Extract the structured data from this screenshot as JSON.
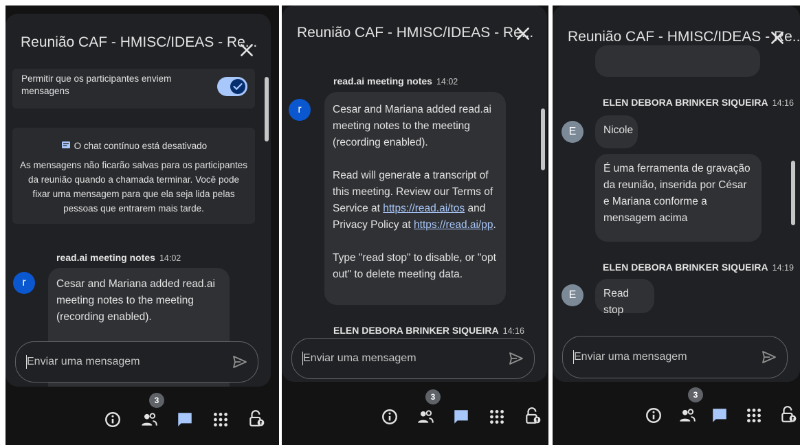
{
  "app": {
    "title": "Reunião CAF - HMISC/IDEAS - Re..."
  },
  "settings": {
    "allow_messages_label": "Permitir que os participantes enviem mensagens",
    "continuous_chat_title": "O chat contínuo está desativado",
    "continuous_chat_body": "As mensagens não ficarão salvas para os participantes da reunião quando a chamada terminar. Você pode fixar uma mensagem para que ela seja lida pelas pessoas que entrarem mais tarde."
  },
  "messages": {
    "readai": {
      "sender": "read.ai meeting notes",
      "time": "14:02",
      "avatar": "r",
      "para1": "Cesar and Mariana added read.ai meeting notes to the meeting (recording enabled).",
      "para2_pre": "Read will generate a transcript of this meeting. Review our Terms of Service at ",
      "tos_link": "https://read.ai/tos",
      "para2_mid": " and Privacy Policy at ",
      "pp_link": "https://read.ai/pp",
      "para2_end": ".",
      "para3": "Type \"read stop\" to disable, or \"opt out\" to delete meeting data."
    },
    "elen1": {
      "sender": "ELEN DEBORA BRINKER SIQUEIRA",
      "time": "14:16",
      "avatar": "E",
      "msg1": "Nicole",
      "msg2": "É uma ferramenta de gravação da reunião, inserida por César e Mariana conforme a mensagem acima"
    },
    "elen2": {
      "sender": "ELEN DEBORA BRINKER SIQUEIRA",
      "time": "14:19",
      "avatar": "E",
      "msg1": "Read stop"
    }
  },
  "composer": {
    "placeholder": "Enviar uma mensagem"
  },
  "toolbar": {
    "participants_count": "3"
  },
  "colors": {
    "accent": "#a8c7fa",
    "avatar_r": "#0b57d0",
    "avatar_e": "#7c8a97",
    "chat_active": "#a8c7fa"
  }
}
